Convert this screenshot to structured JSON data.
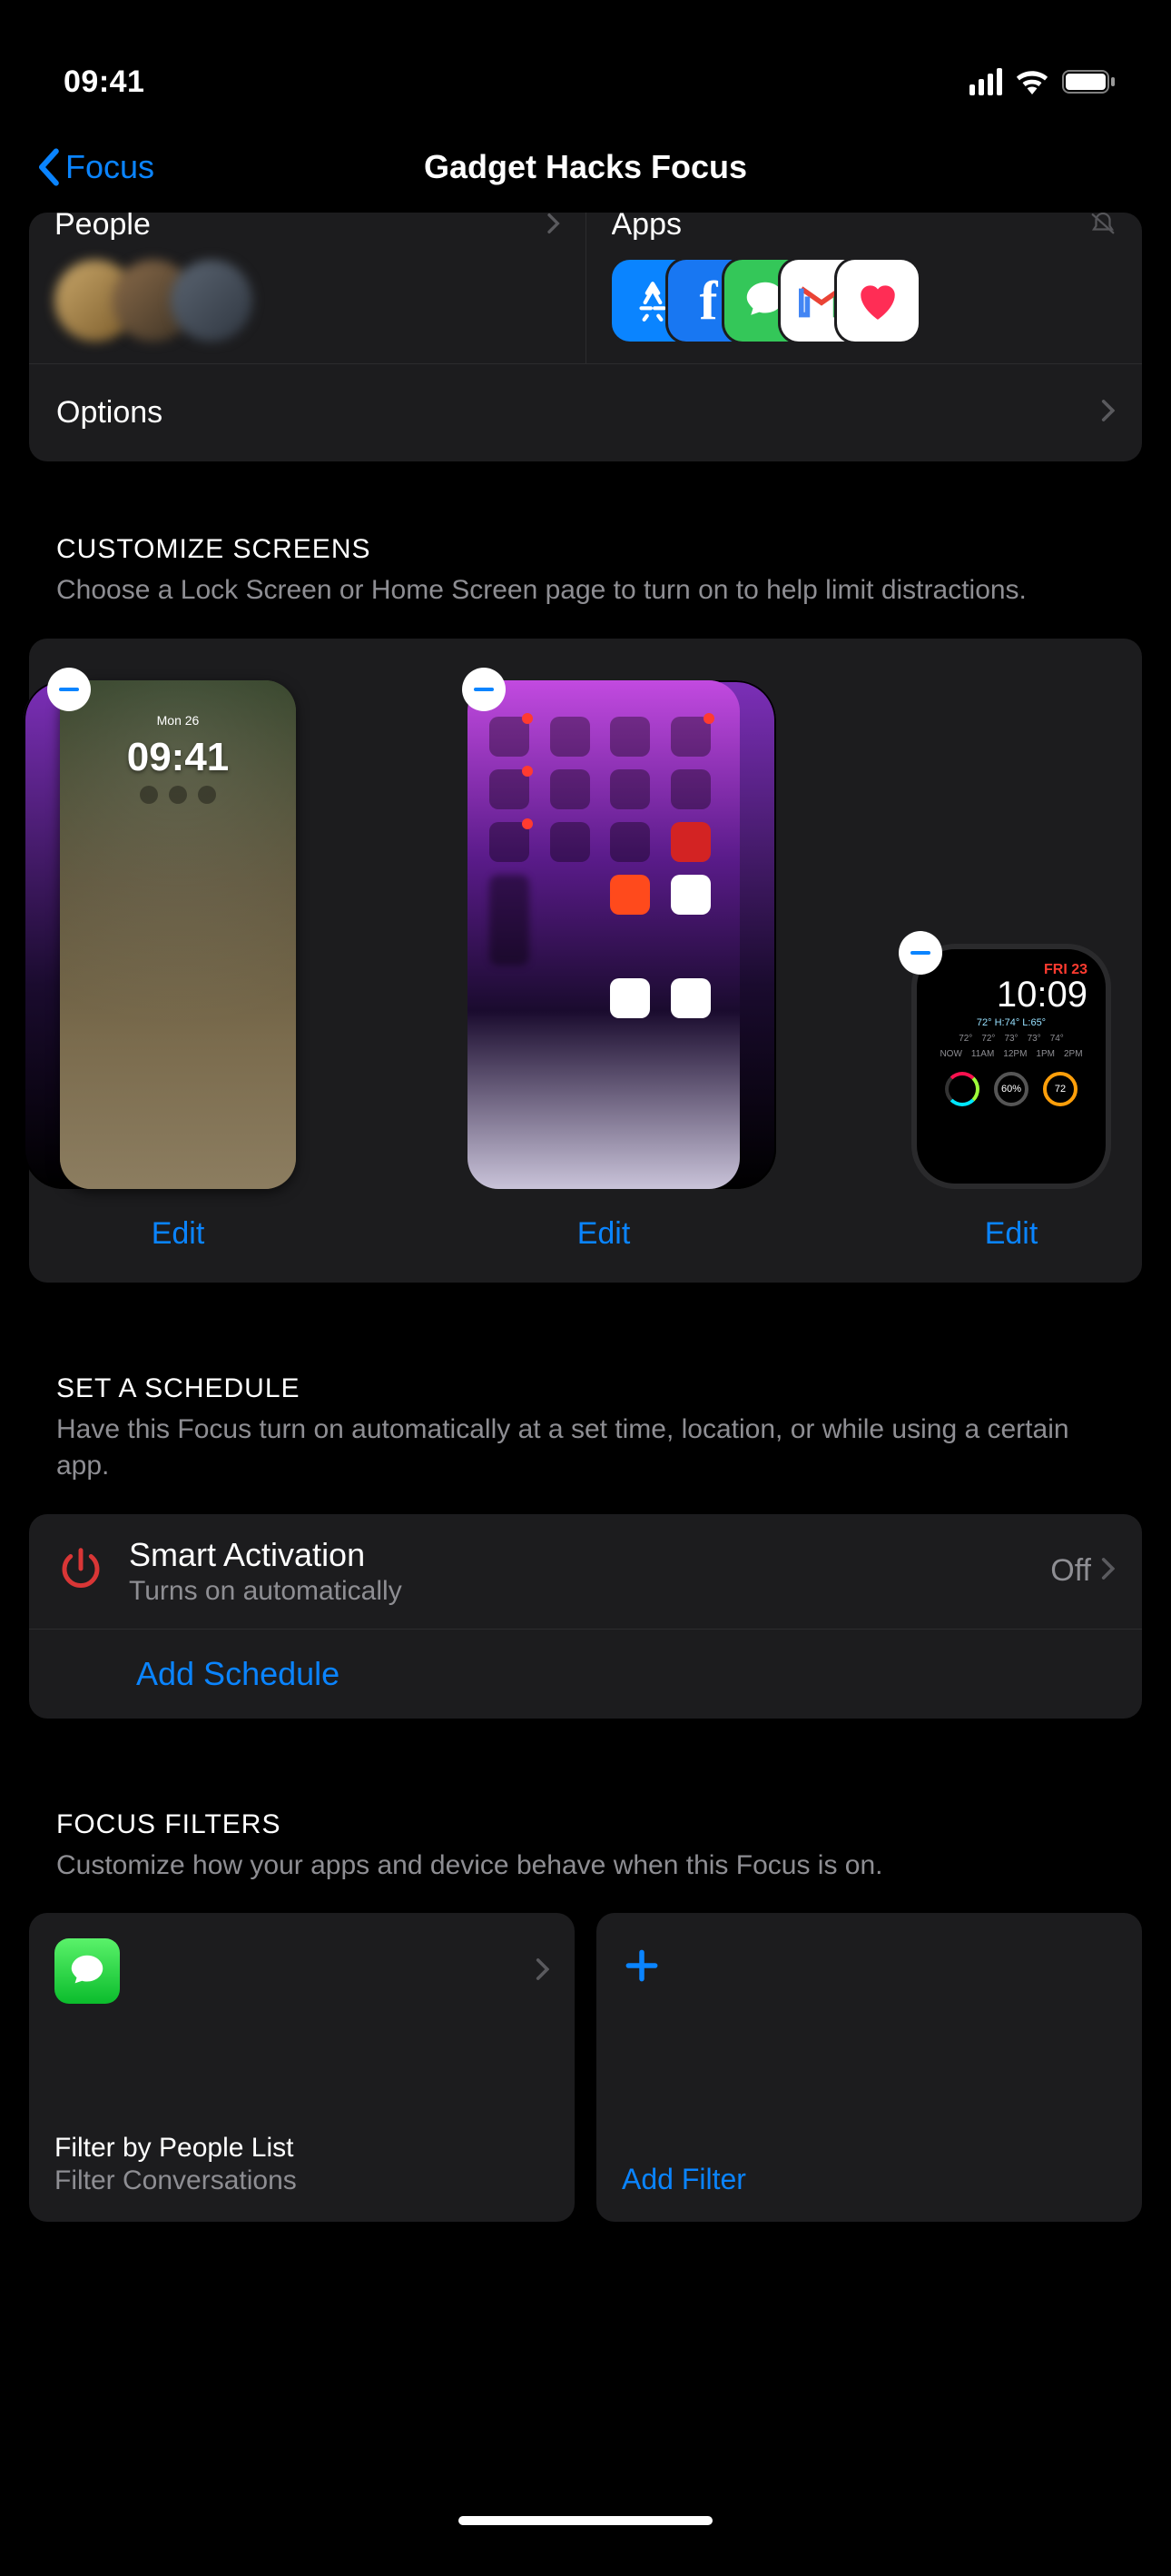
{
  "status": {
    "time": "09:41"
  },
  "nav": {
    "back": "Focus",
    "title": "Gadget Hacks Focus"
  },
  "notifications": {
    "people_label": "People",
    "apps_label": "Apps",
    "options_label": "Options"
  },
  "customize": {
    "header": "CUSTOMIZE SCREENS",
    "desc": "Choose a Lock Screen or Home Screen page to turn on to help limit distractions.",
    "lock_time": "09:41",
    "lock_date": "Mon 26",
    "watch_date": "FRI 23",
    "watch_time": "10:09",
    "watch_weather": "72°  H:74° L:65°",
    "edit": "Edit"
  },
  "schedule": {
    "header": "SET A SCHEDULE",
    "desc": "Have this Focus turn on automatically at a set time, location, or while using a certain app.",
    "smart_title": "Smart Activation",
    "smart_sub": "Turns on automatically",
    "smart_value": "Off",
    "add": "Add Schedule"
  },
  "filters": {
    "header": "FOCUS FILTERS",
    "desc": "Customize how your apps and device behave when this Focus is on.",
    "messages_title": "Filter by People List",
    "messages_sub": "Filter Conversations",
    "add": "Add Filter"
  }
}
